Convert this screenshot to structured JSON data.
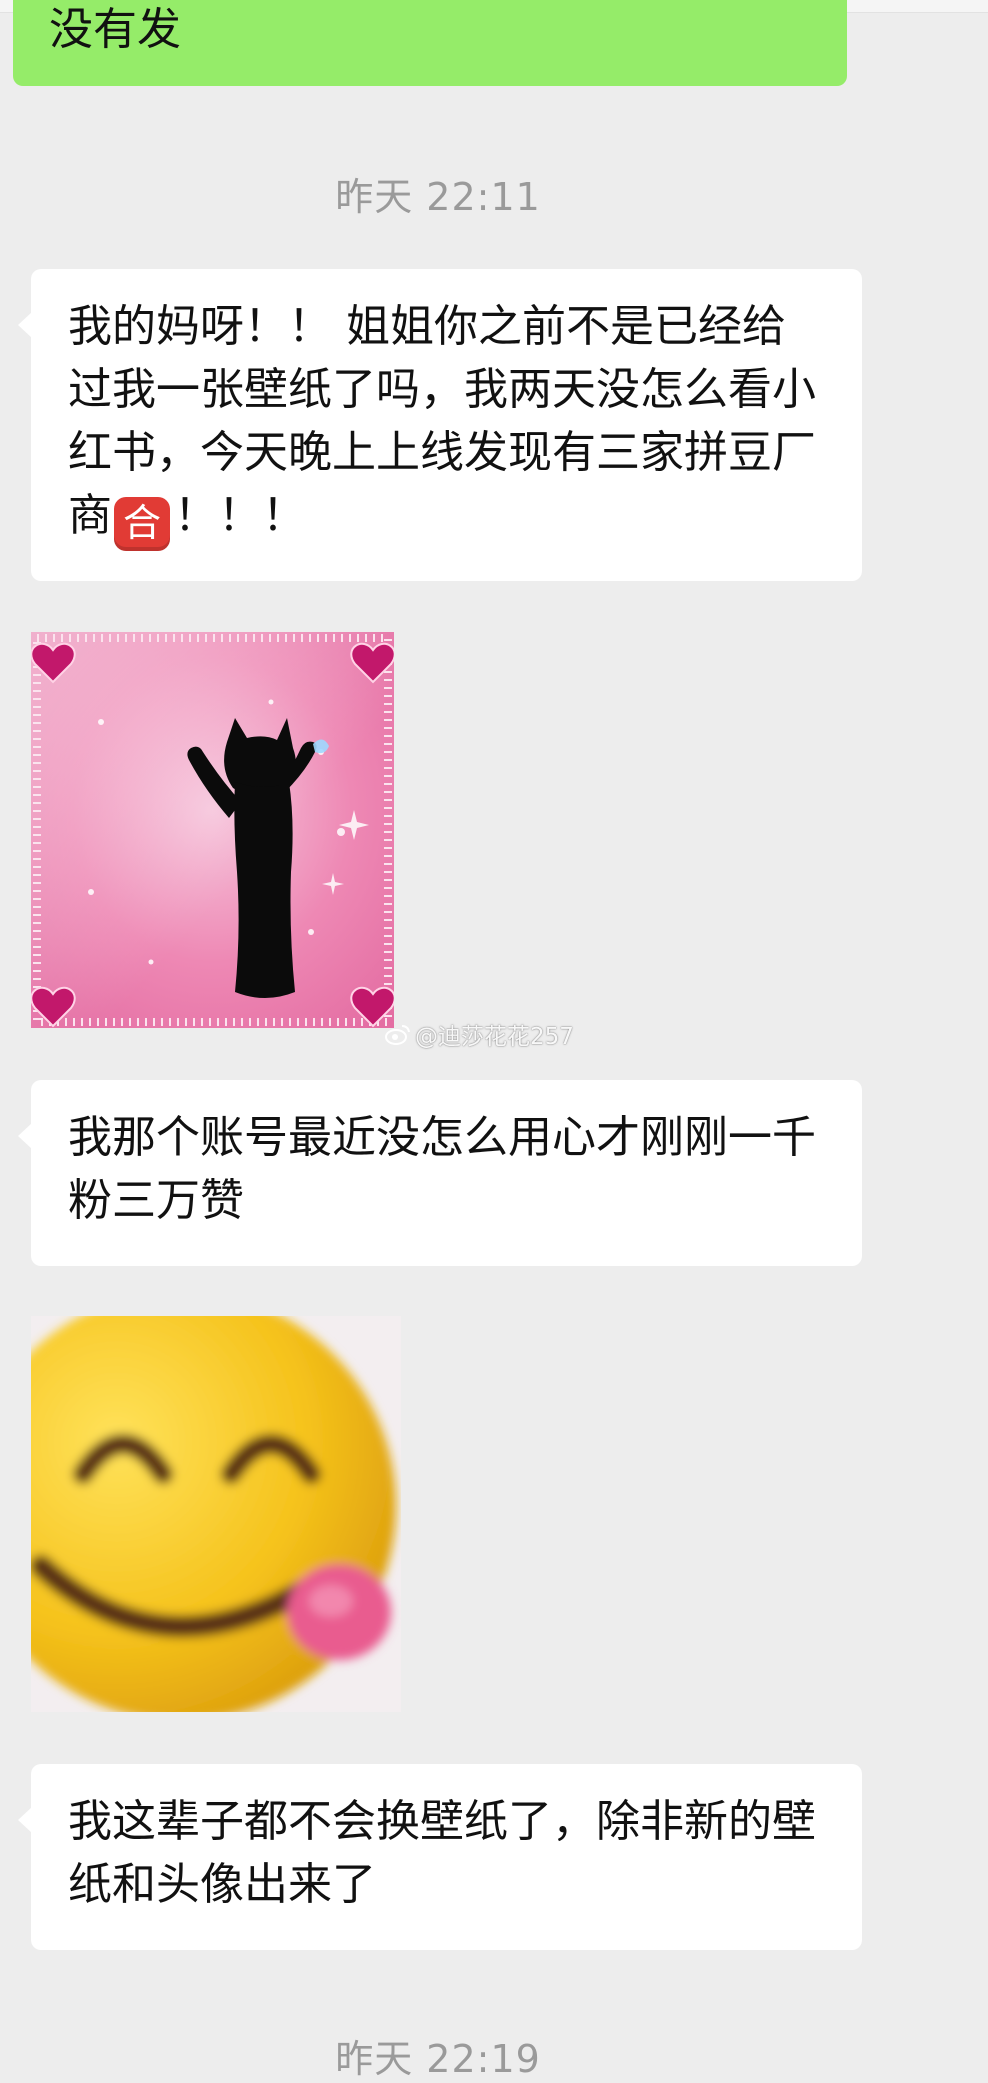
{
  "messages": {
    "top_out_text": "没有发",
    "timestamp_1": "昨天 22:11",
    "msg1_part1": "我的妈呀！！ 姐姐你之前不是已经给过我一张壁纸了吗，我两天没怎么看小红书，今天晚上上线发现有三家拼豆厂商",
    "msg1_emoji": "合",
    "msg1_part2": "！！！",
    "msg2_text": "我那个账号最近没怎么用心才刚刚一千粉三万赞",
    "msg3_text": "我这辈子都不会换壁纸了，除非新的壁纸和头像出来了",
    "timestamp_2": "昨天 22:19"
  },
  "watermark": {
    "text": "@迪莎花花257",
    "icon": "weibo-icon"
  },
  "stickers": {
    "sticker1": "dancing-black-cat-pink-sparkles",
    "sticker2": "smiling-emoji-tongue"
  },
  "colors": {
    "background": "#ededed",
    "outgoing_bubble": "#95ec69",
    "incoming_bubble": "#ffffff",
    "timestamp_text": "#9a9a9a",
    "emoji_badge": "#e13b35"
  }
}
